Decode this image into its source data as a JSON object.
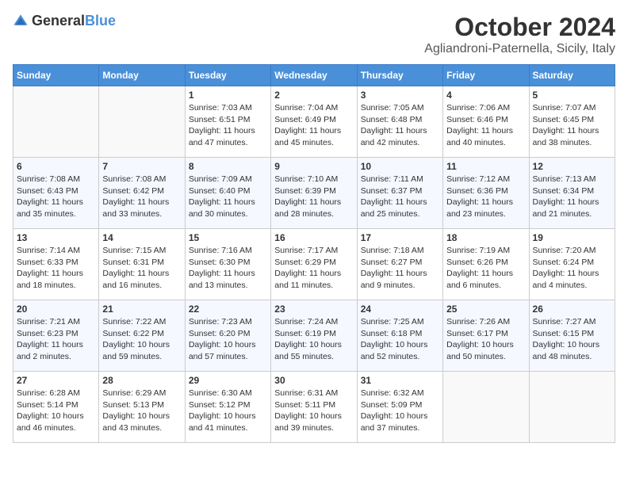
{
  "header": {
    "logo": {
      "general": "General",
      "blue": "Blue"
    },
    "title": "October 2024",
    "location": "Agliandroni-Paternella, Sicily, Italy"
  },
  "calendar": {
    "days_of_week": [
      "Sunday",
      "Monday",
      "Tuesday",
      "Wednesday",
      "Thursday",
      "Friday",
      "Saturday"
    ],
    "weeks": [
      [
        {
          "day": "",
          "info": ""
        },
        {
          "day": "",
          "info": ""
        },
        {
          "day": "1",
          "info": "Sunrise: 7:03 AM\nSunset: 6:51 PM\nDaylight: 11 hours and 47 minutes."
        },
        {
          "day": "2",
          "info": "Sunrise: 7:04 AM\nSunset: 6:49 PM\nDaylight: 11 hours and 45 minutes."
        },
        {
          "day": "3",
          "info": "Sunrise: 7:05 AM\nSunset: 6:48 PM\nDaylight: 11 hours and 42 minutes."
        },
        {
          "day": "4",
          "info": "Sunrise: 7:06 AM\nSunset: 6:46 PM\nDaylight: 11 hours and 40 minutes."
        },
        {
          "day": "5",
          "info": "Sunrise: 7:07 AM\nSunset: 6:45 PM\nDaylight: 11 hours and 38 minutes."
        }
      ],
      [
        {
          "day": "6",
          "info": "Sunrise: 7:08 AM\nSunset: 6:43 PM\nDaylight: 11 hours and 35 minutes."
        },
        {
          "day": "7",
          "info": "Sunrise: 7:08 AM\nSunset: 6:42 PM\nDaylight: 11 hours and 33 minutes."
        },
        {
          "day": "8",
          "info": "Sunrise: 7:09 AM\nSunset: 6:40 PM\nDaylight: 11 hours and 30 minutes."
        },
        {
          "day": "9",
          "info": "Sunrise: 7:10 AM\nSunset: 6:39 PM\nDaylight: 11 hours and 28 minutes."
        },
        {
          "day": "10",
          "info": "Sunrise: 7:11 AM\nSunset: 6:37 PM\nDaylight: 11 hours and 25 minutes."
        },
        {
          "day": "11",
          "info": "Sunrise: 7:12 AM\nSunset: 6:36 PM\nDaylight: 11 hours and 23 minutes."
        },
        {
          "day": "12",
          "info": "Sunrise: 7:13 AM\nSunset: 6:34 PM\nDaylight: 11 hours and 21 minutes."
        }
      ],
      [
        {
          "day": "13",
          "info": "Sunrise: 7:14 AM\nSunset: 6:33 PM\nDaylight: 11 hours and 18 minutes."
        },
        {
          "day": "14",
          "info": "Sunrise: 7:15 AM\nSunset: 6:31 PM\nDaylight: 11 hours and 16 minutes."
        },
        {
          "day": "15",
          "info": "Sunrise: 7:16 AM\nSunset: 6:30 PM\nDaylight: 11 hours and 13 minutes."
        },
        {
          "day": "16",
          "info": "Sunrise: 7:17 AM\nSunset: 6:29 PM\nDaylight: 11 hours and 11 minutes."
        },
        {
          "day": "17",
          "info": "Sunrise: 7:18 AM\nSunset: 6:27 PM\nDaylight: 11 hours and 9 minutes."
        },
        {
          "day": "18",
          "info": "Sunrise: 7:19 AM\nSunset: 6:26 PM\nDaylight: 11 hours and 6 minutes."
        },
        {
          "day": "19",
          "info": "Sunrise: 7:20 AM\nSunset: 6:24 PM\nDaylight: 11 hours and 4 minutes."
        }
      ],
      [
        {
          "day": "20",
          "info": "Sunrise: 7:21 AM\nSunset: 6:23 PM\nDaylight: 11 hours and 2 minutes."
        },
        {
          "day": "21",
          "info": "Sunrise: 7:22 AM\nSunset: 6:22 PM\nDaylight: 10 hours and 59 minutes."
        },
        {
          "day": "22",
          "info": "Sunrise: 7:23 AM\nSunset: 6:20 PM\nDaylight: 10 hours and 57 minutes."
        },
        {
          "day": "23",
          "info": "Sunrise: 7:24 AM\nSunset: 6:19 PM\nDaylight: 10 hours and 55 minutes."
        },
        {
          "day": "24",
          "info": "Sunrise: 7:25 AM\nSunset: 6:18 PM\nDaylight: 10 hours and 52 minutes."
        },
        {
          "day": "25",
          "info": "Sunrise: 7:26 AM\nSunset: 6:17 PM\nDaylight: 10 hours and 50 minutes."
        },
        {
          "day": "26",
          "info": "Sunrise: 7:27 AM\nSunset: 6:15 PM\nDaylight: 10 hours and 48 minutes."
        }
      ],
      [
        {
          "day": "27",
          "info": "Sunrise: 6:28 AM\nSunset: 5:14 PM\nDaylight: 10 hours and 46 minutes."
        },
        {
          "day": "28",
          "info": "Sunrise: 6:29 AM\nSunset: 5:13 PM\nDaylight: 10 hours and 43 minutes."
        },
        {
          "day": "29",
          "info": "Sunrise: 6:30 AM\nSunset: 5:12 PM\nDaylight: 10 hours and 41 minutes."
        },
        {
          "day": "30",
          "info": "Sunrise: 6:31 AM\nSunset: 5:11 PM\nDaylight: 10 hours and 39 minutes."
        },
        {
          "day": "31",
          "info": "Sunrise: 6:32 AM\nSunset: 5:09 PM\nDaylight: 10 hours and 37 minutes."
        },
        {
          "day": "",
          "info": ""
        },
        {
          "day": "",
          "info": ""
        }
      ]
    ]
  }
}
